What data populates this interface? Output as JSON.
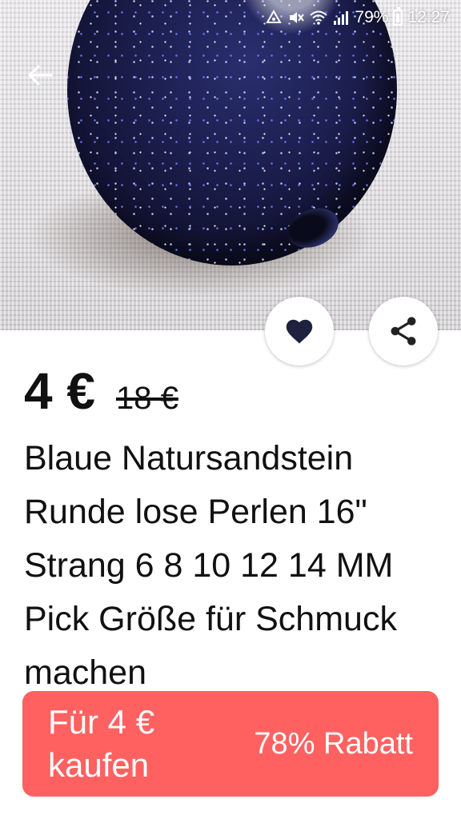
{
  "status_bar": {
    "battery_percent": "79%",
    "time": "12:27",
    "icons": [
      "data-saver-icon",
      "mute-icon",
      "wifi-icon",
      "signal-icon",
      "battery-icon"
    ]
  },
  "toolbar": {
    "back_icon": "arrow-left-icon"
  },
  "actions": {
    "favorite_icon": "heart-icon",
    "share_icon": "share-icon"
  },
  "product": {
    "price": "4 €",
    "original_price": "18 €",
    "title": "Blaue Natursandstein Runde lose Perlen 16\" Strang 6 8 10 12 14 MM Pick Größe für Schmuck machen"
  },
  "purchase": {
    "buy_label": "Für 4 € kaufen",
    "discount_label": "78% Rabatt",
    "accent_color": "#ff6161"
  }
}
